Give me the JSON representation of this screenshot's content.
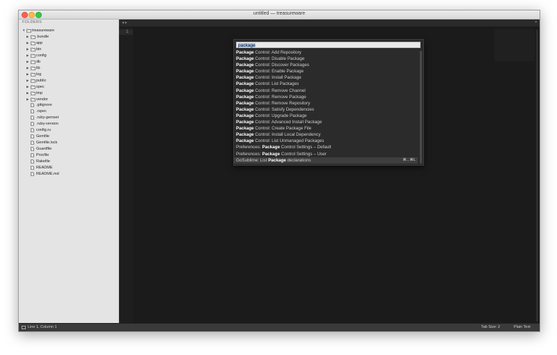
{
  "window": {
    "title": "untitled — treasureware"
  },
  "sidebar": {
    "header": "FOLDERS",
    "root": "treasureware",
    "folders": [
      ".bundle",
      "app",
      "bin",
      "config",
      "db",
      "lib",
      "log",
      "public",
      "spec",
      "tmp",
      "vendor"
    ],
    "files": [
      ".gitignore",
      ".rspec",
      ".ruby-gemset",
      ".ruby-version",
      "config.ru",
      "Gemfile",
      "Gemfile.lock",
      "Guardfile",
      "Procfile",
      "Rakefile",
      "README",
      "README.md"
    ]
  },
  "editor": {
    "line_number": "1",
    "nav_arrows": "◂ ▸",
    "dropdown_icon": "▾"
  },
  "palette": {
    "query": "package",
    "items": [
      {
        "pre": "",
        "bold": "Package",
        "post": " Control: Add Repository"
      },
      {
        "pre": "",
        "bold": "Package",
        "post": " Control: Disable Package"
      },
      {
        "pre": "",
        "bold": "Package",
        "post": " Control: Discover Packages"
      },
      {
        "pre": "",
        "bold": "Package",
        "post": " Control: Enable Package"
      },
      {
        "pre": "",
        "bold": "Package",
        "post": " Control: Install Package"
      },
      {
        "pre": "",
        "bold": "Package",
        "post": " Control: List Packages"
      },
      {
        "pre": "",
        "bold": "Package",
        "post": " Control: Remove Channel"
      },
      {
        "pre": "",
        "bold": "Package",
        "post": " Control: Remove Package"
      },
      {
        "pre": "",
        "bold": "Package",
        "post": " Control: Remove Repository"
      },
      {
        "pre": "",
        "bold": "Package",
        "post": " Control: Satisfy Dependencies"
      },
      {
        "pre": "",
        "bold": "Package",
        "post": " Control: Upgrade Package"
      },
      {
        "pre": "",
        "bold": "Package",
        "post": " Control: Advanced Install Package"
      },
      {
        "pre": "",
        "bold": "Package",
        "post": " Control: Create Package File"
      },
      {
        "pre": "",
        "bold": "Package",
        "post": " Control: Install Local Dependency"
      },
      {
        "pre": "",
        "bold": "Package",
        "post": " Control: List Unmanaged Packages"
      },
      {
        "pre": "Preferences: ",
        "bold": "Package",
        "post": " Control Settings – Default"
      },
      {
        "pre": "Preferences: ",
        "bold": "Package",
        "post": " Control Settings – User"
      },
      {
        "pre": "GoSublime: List ",
        "bold": "Package",
        "post": " declarations",
        "shortcut": "⌘., ⌘L"
      }
    ]
  },
  "statusbar": {
    "position": "Line 1, Column 1",
    "tab_size": "Tab Size: 2",
    "syntax": "Plain Text"
  }
}
